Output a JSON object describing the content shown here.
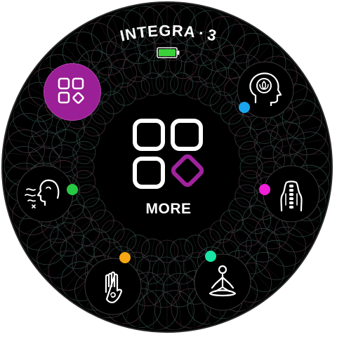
{
  "device": {
    "brand_name": "INTEGRA",
    "brand_suffix": "3",
    "battery_level": 1.0,
    "battery_color": "#3bd13a"
  },
  "center": {
    "label": "MORE",
    "icon": "apps-grid-icon",
    "accent": "#a0239e"
  },
  "apps": [
    {
      "id": "apps-menu",
      "icon": "apps-grid-icon",
      "bg": "#9b1f96",
      "selected": true
    },
    {
      "id": "mind",
      "icon": "head-lotus-icon",
      "dot": "#1aa6ee"
    },
    {
      "id": "spine",
      "icon": "spine-back-icon",
      "dot": "#ef1ed9"
    },
    {
      "id": "meditation",
      "icon": "meditation-pose-icon",
      "dot": "#19e5a6"
    },
    {
      "id": "hand",
      "icon": "hand-swirl-icon",
      "dot": "#f6a713"
    },
    {
      "id": "breathing",
      "icon": "breathing-face-icon",
      "dot": "#27c844"
    }
  ]
}
